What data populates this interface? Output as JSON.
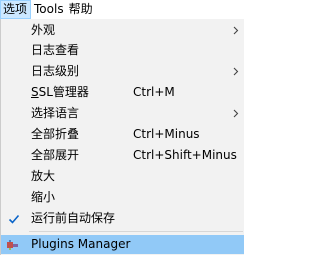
{
  "menubar": {
    "items": [
      {
        "label": "选项",
        "active": true
      },
      {
        "label": "Tools",
        "active": false
      },
      {
        "label": "帮助",
        "active": false
      }
    ]
  },
  "dropdown": {
    "items": [
      {
        "label": "外观",
        "shortcut": "",
        "submenu": true
      },
      {
        "label": "日志查看",
        "shortcut": "",
        "submenu": false
      },
      {
        "label": "日志级别",
        "shortcut": "",
        "submenu": true
      },
      {
        "label_underlined": "S",
        "label_rest": "SL管理器",
        "shortcut": "Ctrl+M",
        "submenu": false
      },
      {
        "label": "选择语言",
        "shortcut": "",
        "submenu": true
      },
      {
        "label": "全部折叠",
        "shortcut": "Ctrl+Minus",
        "submenu": false
      },
      {
        "label": "全部展开",
        "shortcut": "Ctrl+Shift+Minus",
        "submenu": false
      },
      {
        "label": "放大",
        "shortcut": "",
        "submenu": false
      },
      {
        "label": "缩小",
        "shortcut": "",
        "submenu": false
      },
      {
        "label": "运行前自动保存",
        "shortcut": "",
        "submenu": false,
        "checked": true
      },
      {
        "label": "Plugins Manager",
        "shortcut": "",
        "submenu": false,
        "highlighted": true
      }
    ]
  },
  "colors": {
    "menu_bg": "#f2f2f2",
    "highlight": "#91c9f7",
    "active_menubar": "#cce8ff",
    "check": "#0a64c8"
  },
  "icons": {
    "submenu": "chevron-right-icon",
    "checked": "checkmark-icon",
    "plugins": "plugin-icon"
  }
}
